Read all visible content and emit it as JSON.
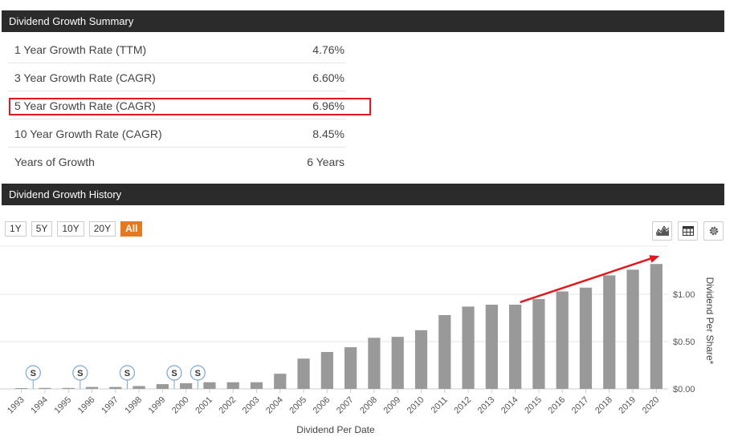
{
  "summary": {
    "title": "Dividend Growth Summary",
    "rows": [
      {
        "label": "1 Year Growth Rate (TTM)",
        "value": "4.76%"
      },
      {
        "label": "3 Year Growth Rate (CAGR)",
        "value": "6.60%"
      },
      {
        "label": "5 Year Growth Rate (CAGR)",
        "value": "6.96%"
      },
      {
        "label": "10 Year Growth Rate (CAGR)",
        "value": "8.45%"
      },
      {
        "label": "Years of Growth",
        "value": "6 Years"
      }
    ],
    "highlight_color": "#e0191f"
  },
  "history": {
    "title": "Dividend Growth History",
    "ranges": [
      "1Y",
      "5Y",
      "10Y",
      "20Y",
      "All"
    ],
    "active_range": "All",
    "active_color": "#e8781e",
    "tools": [
      "area-chart-icon",
      "table-icon",
      "settings-gear-icon"
    ]
  },
  "chart_data": {
    "type": "bar",
    "xlabel": "Dividend Per Date",
    "ylabel": "Dividend Per Share*",
    "categories": [
      "1993",
      "1994",
      "1995",
      "1996",
      "1997",
      "1998",
      "1999",
      "2000",
      "2001",
      "2002",
      "2003",
      "2004",
      "2005",
      "2006",
      "2007",
      "2008",
      "2009",
      "2010",
      "2011",
      "2012",
      "2013",
      "2014",
      "2015",
      "2016",
      "2017",
      "2018",
      "2019",
      "2020"
    ],
    "values": [
      0.0,
      0.01,
      0.01,
      0.02,
      0.02,
      0.03,
      0.05,
      0.06,
      0.07,
      0.07,
      0.07,
      0.16,
      0.32,
      0.39,
      0.44,
      0.54,
      0.55,
      0.62,
      0.78,
      0.87,
      0.89,
      0.89,
      0.95,
      1.03,
      1.07,
      1.2,
      1.26,
      1.32
    ],
    "ylim": [
      0,
      1.5
    ],
    "yticks": [
      0,
      0.5,
      1.0
    ],
    "ytick_labels": [
      "$0.00",
      "$0.50",
      "$1.00"
    ],
    "bar_color": "#999999",
    "split_markers": [
      {
        "label": "S",
        "year": "1993"
      },
      {
        "label": "S",
        "year": "1995"
      },
      {
        "label": "S",
        "year": "1997"
      },
      {
        "label": "S",
        "year": "1999"
      },
      {
        "label": "S",
        "year": "2000"
      }
    ],
    "trend_arrow": {
      "from": "2014",
      "to": "2020",
      "color": "#e0191f"
    },
    "grid": true
  }
}
